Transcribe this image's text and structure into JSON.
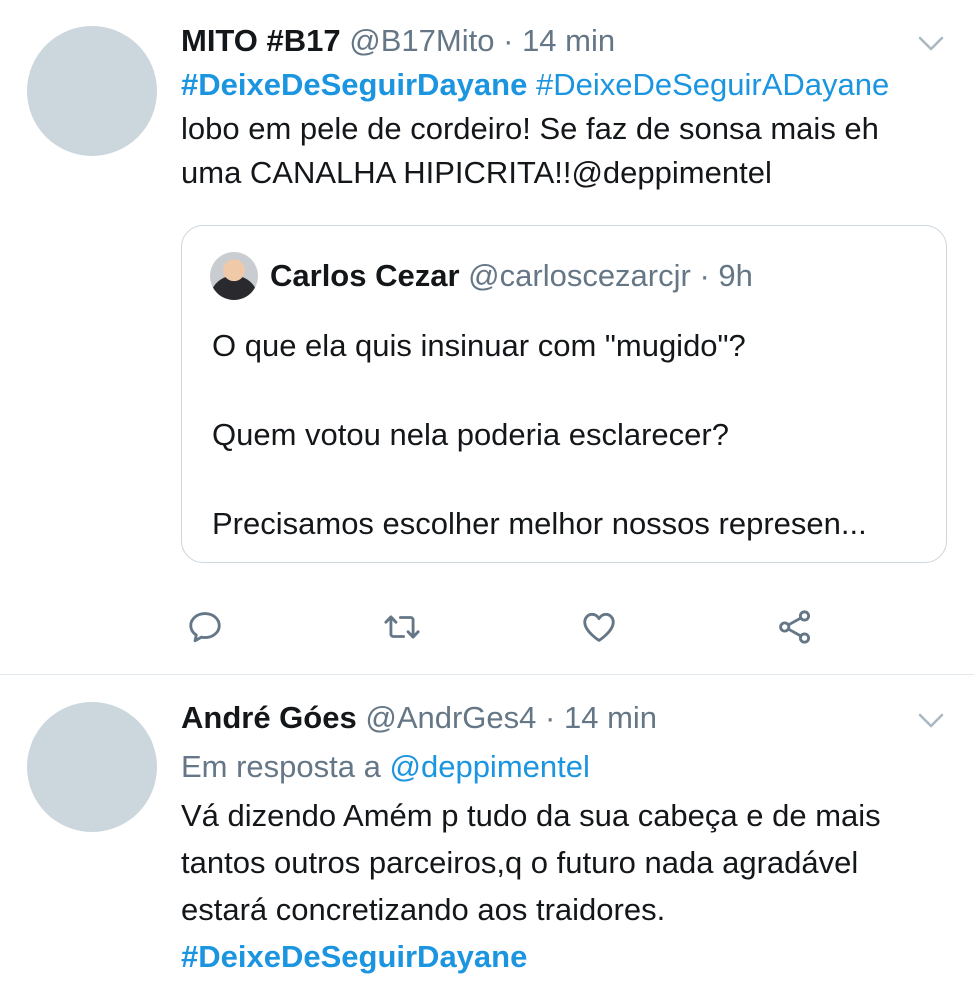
{
  "tweets": [
    {
      "author": "MITO #B17",
      "handle": "@B17Mito",
      "sep": "·",
      "time": "14 min",
      "hashtag1": "#DeixeDeSeguirDayane",
      "hashtag2": "#DeixeDeSeguirADayane",
      "text_line1": "lobo em pele de cordeiro! Se faz de sonsa mais eh",
      "text_line2": "uma CANALHA HIPICRITA!!@deppimentel",
      "quote": {
        "author": "Carlos Cezar",
        "handle": "@carloscezarcjr",
        "sep": "·",
        "time": "9h",
        "para1": "O que ela quis insinuar com \"mugido\"?",
        "para2": "Quem votou nela poderia esclarecer?",
        "para3": "Precisamos escolher melhor nossos represen..."
      },
      "actions": [
        "reply-icon",
        "retweet-icon",
        "like-icon",
        "share-icon"
      ]
    },
    {
      "author": "André Góes",
      "handle": "@AndrGes4",
      "sep": "·",
      "time": "14 min",
      "reply_prefix": "Em resposta a",
      "reply_handle": "@deppimentel",
      "text_line1": "Vá dizendo Amém p tudo da sua cabeça e de mais",
      "text_line2": "tantos outros parceiros,q o futuro nada agradável",
      "text_line3": "estará concretizando aos traidores.",
      "hashtag": "#DeixeDeSeguirDayane"
    }
  ],
  "colors": {
    "link": "#1b95e0",
    "meta": "#657786",
    "avatar_placeholder": "#ccd6dd",
    "border": "#ccd6dd",
    "divider": "#e1e8ed"
  }
}
